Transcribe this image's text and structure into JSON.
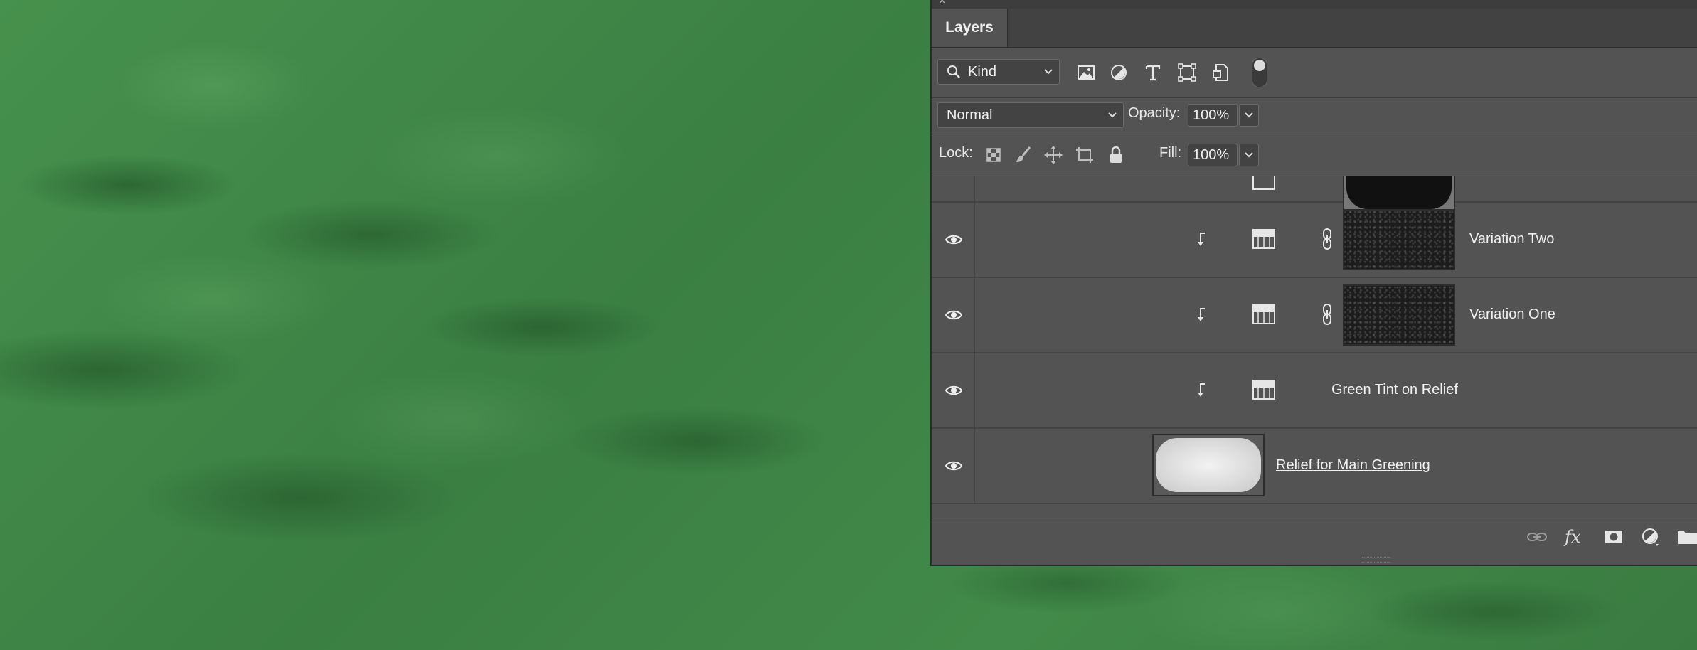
{
  "panel": {
    "close_glyph": "×",
    "tab_label": "Layers"
  },
  "filter": {
    "kind_label": "Kind",
    "icons": [
      "image-filter-icon",
      "adjustment-filter-icon",
      "type-filter-icon",
      "shape-filter-icon",
      "smart-object-filter-icon"
    ]
  },
  "blend": {
    "mode": "Normal",
    "opacity_label": "Opacity:",
    "opacity_value": "100%"
  },
  "lock": {
    "label": "Lock:",
    "fill_label": "Fill:",
    "fill_value": "100%"
  },
  "layers": [
    {
      "name": "Variation Two",
      "visible": true,
      "clipped": true,
      "type": "adjustment",
      "has_mask": true
    },
    {
      "name": "Variation One",
      "visible": true,
      "clipped": true,
      "type": "adjustment",
      "has_mask": true
    },
    {
      "name": "Green Tint on Relief",
      "visible": true,
      "clipped": true,
      "type": "adjustment",
      "has_mask": false
    },
    {
      "name": "Relief for Main Greening",
      "visible": true,
      "clipped": false,
      "type": "smart-object",
      "has_mask": false
    }
  ],
  "bottom_toolbar": {
    "fx_label": "fx",
    "icons": [
      "link-layers-icon",
      "fx-icon",
      "add-mask-icon",
      "new-adjustment-icon",
      "new-group-icon"
    ]
  },
  "colors": {
    "panel_bg": "#535353",
    "canvas_green": "#3f8346"
  }
}
